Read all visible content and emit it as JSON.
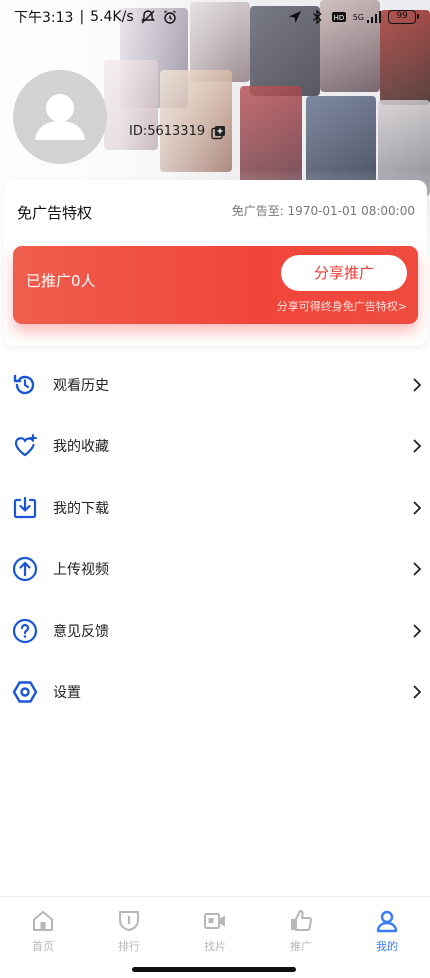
{
  "status_bar": {
    "time": "下午3:13",
    "speed": "5.4K/s",
    "network": "5G",
    "battery": "99"
  },
  "profile": {
    "user_id": "ID:5613319"
  },
  "vip": {
    "title": "免广告特权",
    "expire_text": "免广告至: 1970-01-01 08:00:00",
    "promoted_count": "已推广0人",
    "share_button": "分享推广",
    "share_tip": "分享可得终身免广告特权>"
  },
  "menu": {
    "items": [
      {
        "label": "观看历史",
        "icon": "history-icon"
      },
      {
        "label": "我的收藏",
        "icon": "favorite-heart-icon"
      },
      {
        "label": "我的下载",
        "icon": "download-icon"
      },
      {
        "label": "上传视频",
        "icon": "upload-icon"
      },
      {
        "label": "意见反馈",
        "icon": "feedback-question-icon"
      },
      {
        "label": "设置",
        "icon": "settings-icon"
      }
    ]
  },
  "tabbar": {
    "tabs": [
      {
        "label": "首页",
        "icon": "home-icon"
      },
      {
        "label": "排行",
        "icon": "ranking-icon"
      },
      {
        "label": "找片",
        "icon": "video-camera-icon"
      },
      {
        "label": "推广",
        "icon": "thumbs-up-icon"
      },
      {
        "label": "我的",
        "icon": "user-icon",
        "active": true
      }
    ]
  },
  "colors": {
    "accent_blue": "#1a56d6",
    "promo_red": "#f0453a",
    "tab_active": "#3b7cf5",
    "tab_inactive": "#b7b7b7"
  }
}
